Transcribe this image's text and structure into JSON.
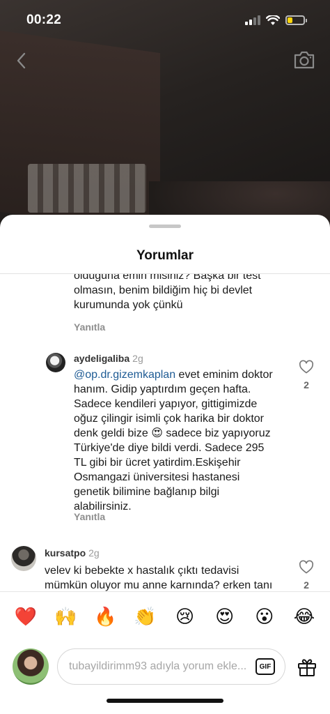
{
  "status_bar": {
    "time": "00:22"
  },
  "icons": {
    "back": "chevron-left-icon",
    "camera": "camera-icon",
    "like": "heart-outline-icon",
    "gift": "gift-icon"
  },
  "sheet": {
    "title": "Yorumlar"
  },
  "partial_comment": {
    "text": "olduğuna emin misiniz? Başka bir test olmasın, benim bildiğim hiç bi devlet kurumunda yok çünkü",
    "reply_label": "Yanıtla"
  },
  "reply_comment": {
    "username": "aydeligaliba",
    "time_ago": "2g",
    "mention": "@op.dr.gizemkaplan",
    "text": " evet eminim doktor hanım. Gidip yaptırdım geçen hafta. Sadece kendileri yapıyor, gittigimizde oğuz çilingir isimli çok harika bir doktor denk geldi bize 😍 sadece biz yapıyoruz Türkiye'de diye bildi verdi. Sadece 295 TL gibi bir ücret yatirdim.Eskişehir Osmangazi üniversitesi hastanesi genetik bilimine bağlanıp bilgi alabilirsiniz.",
    "reply_label": "Yanıtla",
    "likes": "2"
  },
  "top_comment": {
    "username": "kursatpo",
    "time_ago": "2g",
    "text": "velev ki bebekte x hastalık çıktı tedavisi mümkün oluyor mu anne karnında? erken tanı ile neler yapılabilecek?",
    "likes": "2"
  },
  "emoji_bar": [
    "❤️",
    "🙌",
    "🔥",
    "👏",
    "😢",
    "😍",
    "😮",
    "😂"
  ],
  "comment_input": {
    "placeholder": "tubayildirimm93 adıyla yorum ekle...",
    "gif_label": "GIF"
  }
}
